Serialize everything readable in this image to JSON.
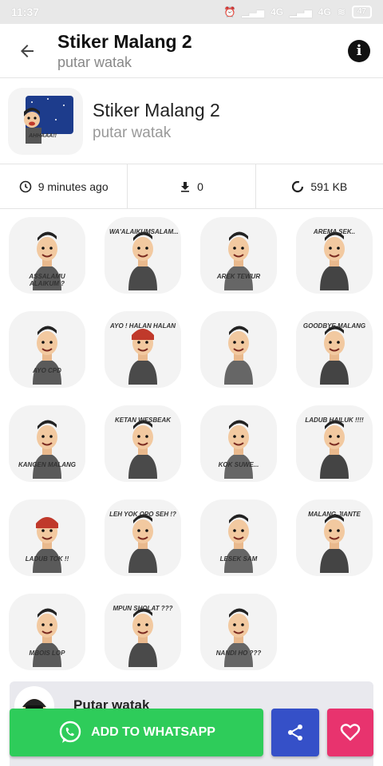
{
  "status": {
    "time": "11:37",
    "signal1": "4G",
    "signal2": "4G",
    "battery": "47"
  },
  "appbar": {
    "title": "Stiker Malang 2",
    "subtitle": "putar watak"
  },
  "pack": {
    "title": "Stiker Malang 2",
    "author": "putar watak",
    "tray_caption": "AHHAAA!!"
  },
  "meta": {
    "time_ago": "9 minutes ago",
    "downloads": "0",
    "size": "591 KB"
  },
  "stickers": [
    {
      "caption": "ASSALAMU ALAIKUM ?"
    },
    {
      "caption": "WA'ALAIKUMSALAM..."
    },
    {
      "caption": "AREK TEWUR"
    },
    {
      "caption": "AREMA SEK.."
    },
    {
      "caption": "AYO CPD"
    },
    {
      "caption": "AYO ! HALAN HALAN"
    },
    {
      "caption": ""
    },
    {
      "caption": "GOODBYE MALANG"
    },
    {
      "caption": "KANGEN MALANG"
    },
    {
      "caption": "KETAN WESBEAK"
    },
    {
      "caption": "KOK SUWE..."
    },
    {
      "caption": "LADUB HAILUK !!!!"
    },
    {
      "caption": "LADUB TOK !!"
    },
    {
      "caption": "LEH YOK OPO SEH !?"
    },
    {
      "caption": "LESEK SAM"
    },
    {
      "caption": "MALANG JIANTE"
    },
    {
      "caption": "MBOIS LOP"
    },
    {
      "caption": "MPUN SHOLAT ???"
    },
    {
      "caption": "NANDI HO ???"
    }
  ],
  "bottom": {
    "author_name": "Putar watak"
  },
  "actions": {
    "add_label": "ADD TO WHATSAPP"
  },
  "colors": {
    "add": "#2ecc5a",
    "share": "#3550c8",
    "fav": "#e8336e"
  }
}
